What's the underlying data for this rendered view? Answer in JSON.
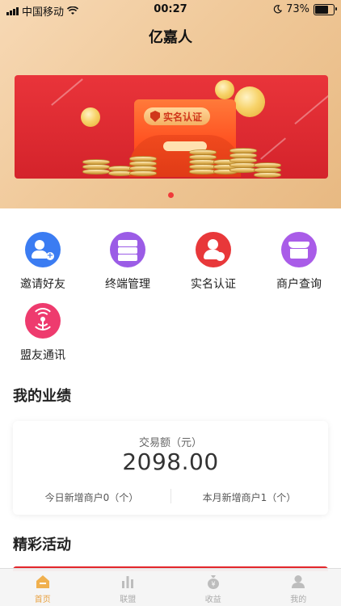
{
  "status_bar": {
    "carrier": "中国移动",
    "time": "00:27",
    "battery": "73%",
    "battery_level": 0.73
  },
  "app": {
    "title": "亿嘉人"
  },
  "banner": {
    "badge_text": "实名认证",
    "pages": 1,
    "active_page": 1
  },
  "menu": {
    "items": [
      {
        "label": "邀请好友",
        "icon": "invite-friend-icon",
        "color": "#3b7cf2"
      },
      {
        "label": "终端管理",
        "icon": "terminal-manage-icon",
        "color": "#9b5ce6"
      },
      {
        "label": "实名认证",
        "icon": "real-name-auth-icon",
        "color": "#e8383a"
      },
      {
        "label": "商户查询",
        "icon": "merchant-query-icon",
        "color": "#a95ce8"
      },
      {
        "label": "盟友通讯",
        "icon": "ally-comm-icon",
        "color": "#ee3b6e"
      }
    ]
  },
  "performance": {
    "section_title": "我的业绩",
    "amount_label": "交易额（元）",
    "amount_value": "2098.00",
    "today_new": "今日新增商户0（个）",
    "month_new": "本月新增商户1（个）"
  },
  "activities": {
    "section_title": "精彩活动"
  },
  "tab_bar": {
    "active": "home",
    "tabs": [
      {
        "id": "home",
        "label": "首页",
        "icon": "home-icon"
      },
      {
        "id": "alliance",
        "label": "联盟",
        "icon": "bar-chart-icon"
      },
      {
        "id": "earnings",
        "label": "收益",
        "icon": "money-bag-icon"
      },
      {
        "id": "mine",
        "label": "我的",
        "icon": "user-icon"
      }
    ]
  },
  "colors": {
    "header_gradient_start": "#f7d9b5",
    "banner_red": "#e3262b",
    "active_tab": "#e8a243"
  }
}
